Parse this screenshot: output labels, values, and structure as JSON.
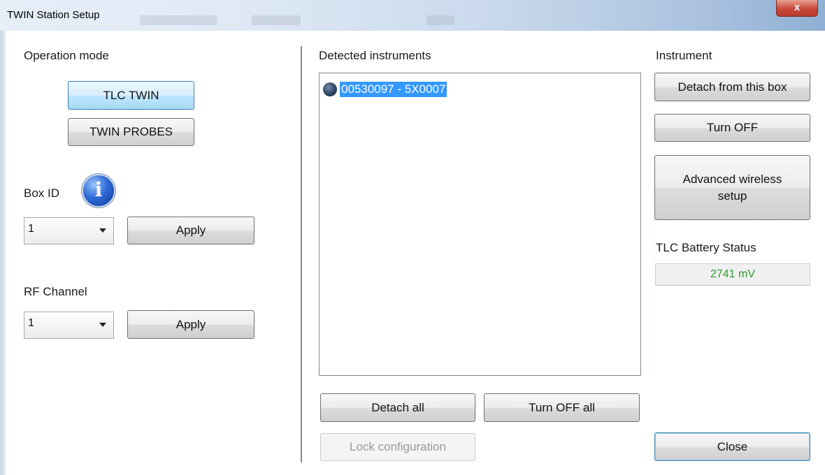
{
  "window": {
    "title": "TWIN Station Setup",
    "close_glyph": "x"
  },
  "operation_mode": {
    "label": "Operation mode",
    "options": [
      "TLC TWIN",
      "TWIN PROBES"
    ],
    "selected": "TLC TWIN"
  },
  "box_id": {
    "label": "Box ID",
    "info_icon": "i",
    "value": "1",
    "apply_label": "Apply"
  },
  "rf_channel": {
    "label": "RF Channel",
    "value": "1",
    "apply_label": "Apply"
  },
  "detected": {
    "label": "Detected instruments",
    "items": [
      "00530097 - 5X0007"
    ],
    "detach_all_label": "Detach all",
    "turn_off_all_label": "Turn OFF all",
    "lock_label": "Lock configuration"
  },
  "instrument": {
    "label": "Instrument",
    "detach_label": "Detach from this box",
    "turn_off_label": "Turn OFF",
    "advanced_label": "Advanced wireless setup",
    "battery_label": "TLC Battery Status",
    "battery_value": "2741 mV"
  },
  "close_label": "Close",
  "colors": {
    "selection": "#3399ff",
    "battery_text": "#2e9a2e",
    "close_red": "#c9493a"
  }
}
